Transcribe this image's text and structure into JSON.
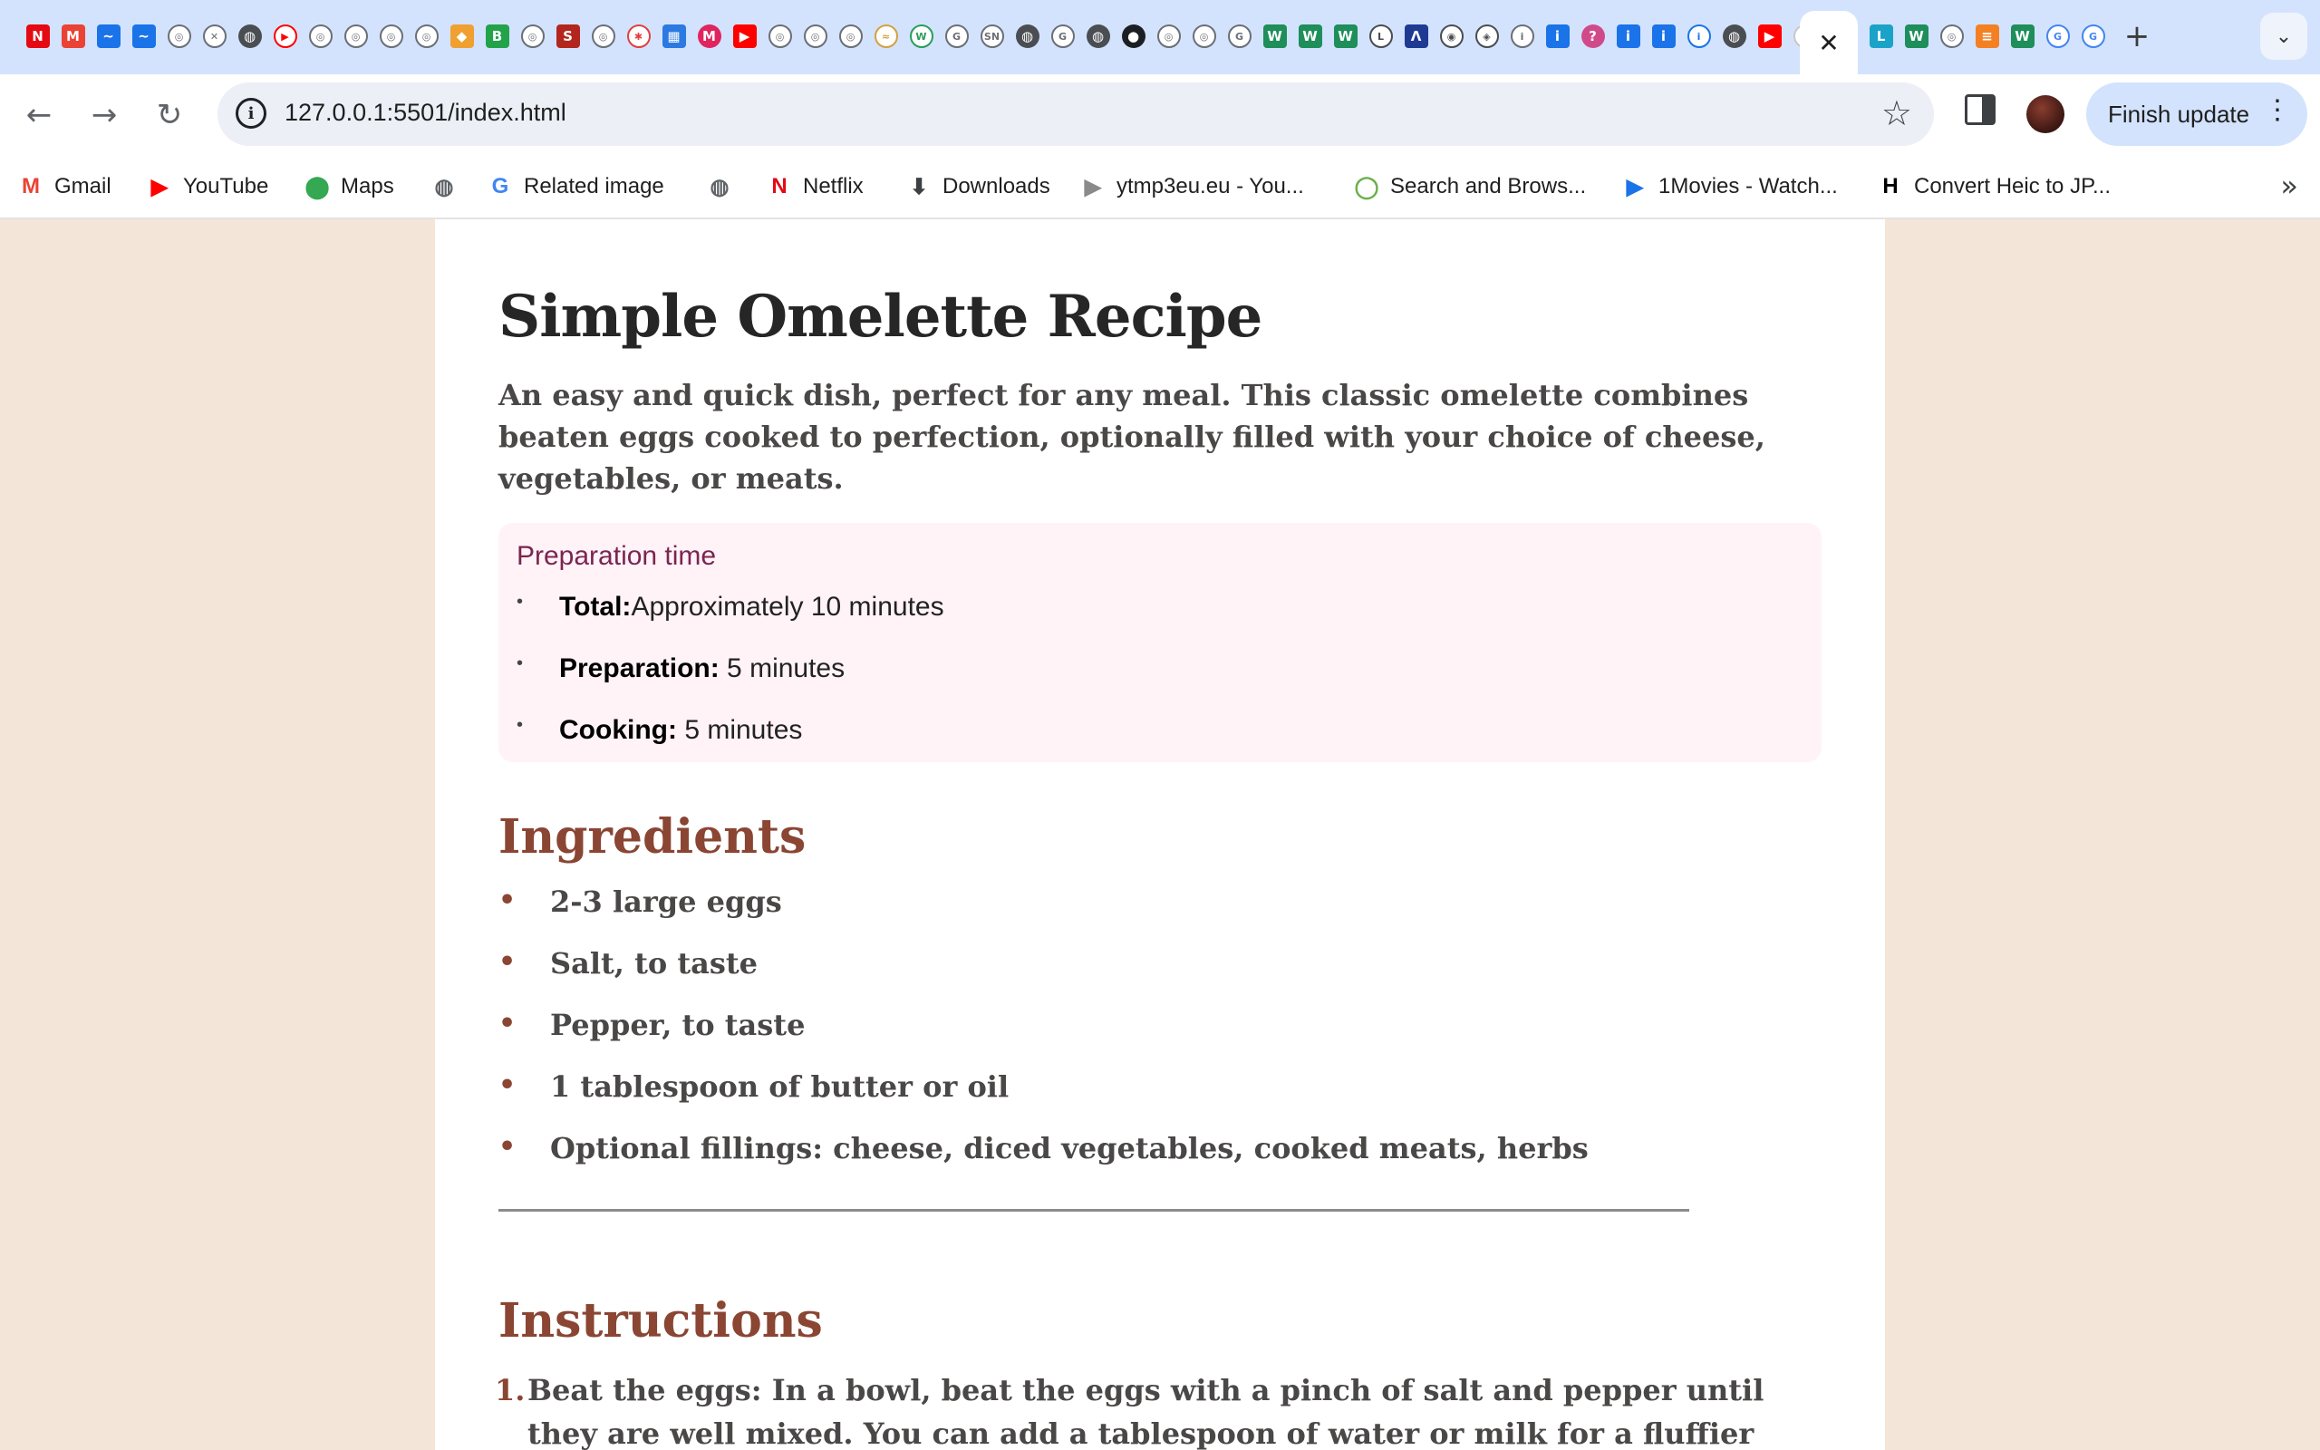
{
  "browser": {
    "url": "127.0.0.1:5501/index.html",
    "finish_update_label": "Finish update",
    "active_tab_close": "✕",
    "new_tab": "+",
    "tab_favicons": [
      {
        "name": "netflix-favicon-icon",
        "glyph": "N",
        "color": "#e50914",
        "shape": "sq"
      },
      {
        "name": "gmail-favicon-icon",
        "glyph": "M",
        "color": "#ea4335",
        "shape": "sq"
      },
      {
        "name": "blue-favicon-icon",
        "glyph": "~",
        "color": "#1a73e8",
        "shape": "sq"
      },
      {
        "name": "blue-favicon-icon",
        "glyph": "~",
        "color": "#1a73e8",
        "shape": "sq"
      },
      {
        "name": "ring-favicon-icon",
        "glyph": "◎",
        "color": "#6b6f76",
        "shape": "ring"
      },
      {
        "name": "x-favicon-icon",
        "glyph": "✕",
        "color": "#6b6f76",
        "shape": "ring"
      },
      {
        "name": "globe-favicon-icon",
        "glyph": "◍",
        "color": "#4a4d52",
        "shape": "globe"
      },
      {
        "name": "youtube-favicon-icon",
        "glyph": "▶",
        "color": "#ff0000",
        "shape": "ring"
      },
      {
        "name": "ring-favicon-icon",
        "glyph": "◎",
        "color": "#6b6f76",
        "shape": "ring"
      },
      {
        "name": "ring-favicon-icon",
        "glyph": "◎",
        "color": "#6b6f76",
        "shape": "ring"
      },
      {
        "name": "ring-favicon-icon",
        "glyph": "◎",
        "color": "#6b6f76",
        "shape": "ring"
      },
      {
        "name": "ring-favicon-icon",
        "glyph": "◎",
        "color": "#6b6f76",
        "shape": "ring"
      },
      {
        "name": "orange-favicon-icon",
        "glyph": "◆",
        "color": "#f0a030",
        "shape": "sq"
      },
      {
        "name": "green-favicon-icon",
        "glyph": "B",
        "color": "#22a34a",
        "shape": "sq"
      },
      {
        "name": "ring-favicon-icon",
        "glyph": "◎",
        "color": "#6b6f76",
        "shape": "ring"
      },
      {
        "name": "red-favicon-icon",
        "glyph": "S",
        "color": "#b3261e",
        "shape": "sq"
      },
      {
        "name": "ring-favicon-icon",
        "glyph": "◎",
        "color": "#6b6f76",
        "shape": "ring"
      },
      {
        "name": "ring-favicon-icon",
        "glyph": "✱",
        "color": "#e04040",
        "shape": "ring"
      },
      {
        "name": "multicolor-favicon-icon",
        "glyph": "▦",
        "color": "#2a7ae2",
        "shape": "sq"
      },
      {
        "name": "red-m-favicon-icon",
        "glyph": "M",
        "color": "#e0245e",
        "shape": "globe"
      },
      {
        "name": "youtube-favicon-icon",
        "glyph": "▶",
        "color": "#ff0000",
        "shape": "sq"
      },
      {
        "name": "ring-favicon-icon",
        "glyph": "◎",
        "color": "#6b6f76",
        "shape": "ring"
      },
      {
        "name": "ring-favicon-icon",
        "glyph": "◎",
        "color": "#6b6f76",
        "shape": "ring"
      },
      {
        "name": "ring-favicon-icon",
        "glyph": "◎",
        "color": "#6b6f76",
        "shape": "ring"
      },
      {
        "name": "ring-favicon-icon",
        "glyph": "≈",
        "color": "#d4a040",
        "shape": "ring"
      },
      {
        "name": "ring-favicon-icon",
        "glyph": "W",
        "color": "#2a9d5a",
        "shape": "ring"
      },
      {
        "name": "ring-favicon-icon",
        "glyph": "G",
        "color": "#6b6f76",
        "shape": "ring"
      },
      {
        "name": "ring-favicon-icon",
        "glyph": "SN",
        "color": "#6b6f76",
        "shape": "ring"
      },
      {
        "name": "globe-favicon-icon",
        "glyph": "◍",
        "color": "#4a4d52",
        "shape": "globe"
      },
      {
        "name": "ring-favicon-icon",
        "glyph": "G",
        "color": "#6b6f76",
        "shape": "ring"
      },
      {
        "name": "globe-favicon-icon",
        "glyph": "◍",
        "color": "#4a4d52",
        "shape": "globe"
      },
      {
        "name": "github-favicon-icon",
        "glyph": "●",
        "color": "#1b1f23",
        "shape": "globe"
      },
      {
        "name": "ring-favicon-icon",
        "glyph": "◎",
        "color": "#6b6f76",
        "shape": "ring"
      },
      {
        "name": "ring-favicon-icon",
        "glyph": "◎",
        "color": "#6b6f76",
        "shape": "ring"
      },
      {
        "name": "ring-favicon-icon",
        "glyph": "G",
        "color": "#6b6f76",
        "shape": "ring"
      },
      {
        "name": "w-favicon-icon",
        "glyph": "W",
        "color": "#1e8e5a",
        "shape": "sq"
      },
      {
        "name": "w-favicon-icon",
        "glyph": "W",
        "color": "#1e8e5a",
        "shape": "sq"
      },
      {
        "name": "w-favicon-icon",
        "glyph": "W",
        "color": "#1e8e5a",
        "shape": "sq"
      },
      {
        "name": "ring-favicon-icon",
        "glyph": "L",
        "color": "#4a4d52",
        "shape": "ring"
      },
      {
        "name": "blue-favicon-icon",
        "glyph": "Λ",
        "color": "#1f3a93",
        "shape": "sq"
      },
      {
        "name": "ring-favicon-icon",
        "glyph": "◉",
        "color": "#4a4d52",
        "shape": "ring"
      },
      {
        "name": "ring-favicon-icon",
        "glyph": "◈",
        "color": "#4a4d52",
        "shape": "ring"
      },
      {
        "name": "info-favicon-icon",
        "glyph": "i",
        "color": "#6b6f76",
        "shape": "ring"
      },
      {
        "name": "info-favicon-icon",
        "glyph": "i",
        "color": "#1a73e8",
        "shape": "sq"
      },
      {
        "name": "pink-favicon-icon",
        "glyph": "?",
        "color": "#d04a8a",
        "shape": "globe"
      },
      {
        "name": "info-favicon-icon",
        "glyph": "i",
        "color": "#1a73e8",
        "shape": "sq"
      },
      {
        "name": "info-favicon-icon",
        "glyph": "i",
        "color": "#1a73e8",
        "shape": "sq"
      },
      {
        "name": "info-favicon-icon",
        "glyph": "i",
        "color": "#1a73e8",
        "shape": "ring"
      },
      {
        "name": "globe-favicon-icon",
        "glyph": "◍",
        "color": "#4a4d52",
        "shape": "globe"
      },
      {
        "name": "youtube-favicon-icon",
        "glyph": "▶",
        "color": "#ff0000",
        "shape": "sq"
      },
      {
        "name": "page-favicon-icon",
        "glyph": "◔",
        "color": "#c8c8c8",
        "shape": "ring"
      }
    ],
    "tab_favicons_right": [
      {
        "name": "l-favicon-icon",
        "glyph": "L",
        "color": "#1aa3c9",
        "shape": "sq"
      },
      {
        "name": "w-favicon-icon",
        "glyph": "W",
        "color": "#1e8e5a",
        "shape": "sq"
      },
      {
        "name": "ring-favicon-icon",
        "glyph": "◎",
        "color": "#6b6f76",
        "shape": "ring"
      },
      {
        "name": "stack-favicon-icon",
        "glyph": "≡",
        "color": "#f48024",
        "shape": "sq"
      },
      {
        "name": "w-favicon-icon",
        "glyph": "W",
        "color": "#1e8e5a",
        "shape": "sq"
      },
      {
        "name": "google-favicon-icon",
        "glyph": "G",
        "color": "#4285f4",
        "shape": "ring"
      },
      {
        "name": "google-favicon-icon",
        "glyph": "G",
        "color": "#4285f4",
        "shape": "ring"
      }
    ]
  },
  "bookmarks": [
    {
      "name": "bookmark-gmail",
      "icon": "gmail-icon",
      "glyph": "M",
      "color": "#ea4335",
      "label": "Gmail"
    },
    {
      "name": "bookmark-youtube",
      "icon": "youtube-icon",
      "glyph": "▶",
      "color": "#ff0000",
      "label": "YouTube"
    },
    {
      "name": "bookmark-maps",
      "icon": "maps-pin-icon",
      "glyph": "⬤",
      "color": "#34a853",
      "label": "Maps"
    },
    {
      "name": "bookmark-globe",
      "icon": "globe-icon",
      "glyph": "◍",
      "color": "#5f6368",
      "label": ""
    },
    {
      "name": "bookmark-related-image",
      "icon": "google-icon",
      "glyph": "G",
      "color": "#4285f4",
      "label": "Related image"
    },
    {
      "name": "bookmark-globe-2",
      "icon": "globe-icon",
      "glyph": "◍",
      "color": "#5f6368",
      "label": ""
    },
    {
      "name": "bookmark-netflix",
      "icon": "netflix-icon",
      "glyph": "N",
      "color": "#e50914",
      "label": "Netflix"
    },
    {
      "name": "bookmark-downloads",
      "icon": "download-icon",
      "glyph": "⬇",
      "color": "#3c4043",
      "label": "Downloads"
    },
    {
      "name": "bookmark-ytmp3",
      "icon": "play-circle-icon",
      "glyph": "▶",
      "color": "#8a8a8a",
      "label": "ytmp3eu.eu - You..."
    },
    {
      "name": "bookmark-yts",
      "icon": "yts-icon",
      "glyph": "◯",
      "color": "#6ab04c",
      "label": "Search and Brows..."
    },
    {
      "name": "bookmark-1movies",
      "icon": "play-frame-icon",
      "glyph": "▶",
      "color": "#1a73e8",
      "label": "1Movies - Watch..."
    },
    {
      "name": "bookmark-heic",
      "icon": "h-circle-icon",
      "glyph": "H",
      "color": "#000000",
      "label": "Convert Heic to JP..."
    }
  ],
  "recipe": {
    "title": "Simple Omelette Recipe",
    "description": "An easy and quick dish, perfect for any meal. This classic omelette combines beaten eggs cooked to perfection, optionally filled with your choice of cheese, vegetables, or meats.",
    "prep": {
      "heading": "Preparation time",
      "items": [
        {
          "label": "Total:",
          "value": "Approximately 10 minutes"
        },
        {
          "label": "Preparation:",
          "value": " 5 minutes"
        },
        {
          "label": "Cooking:",
          "value": " 5 minutes"
        }
      ]
    },
    "ingredients_heading": "Ingredients",
    "ingredients": [
      "2-3 large eggs",
      "Salt, to taste",
      "Pepper, to taste",
      "1 tablespoon of butter or oil",
      "Optional fillings: cheese, diced vegetables, cooked meats, herbs"
    ],
    "instructions_heading": "Instructions",
    "instructions": [
      {
        "num": "1.",
        "text": "Beat the eggs: In a bowl, beat the eggs with a pinch of salt and pepper until they are well mixed. You can add a tablespoon of water or milk for a fluffier texture."
      }
    ]
  }
}
